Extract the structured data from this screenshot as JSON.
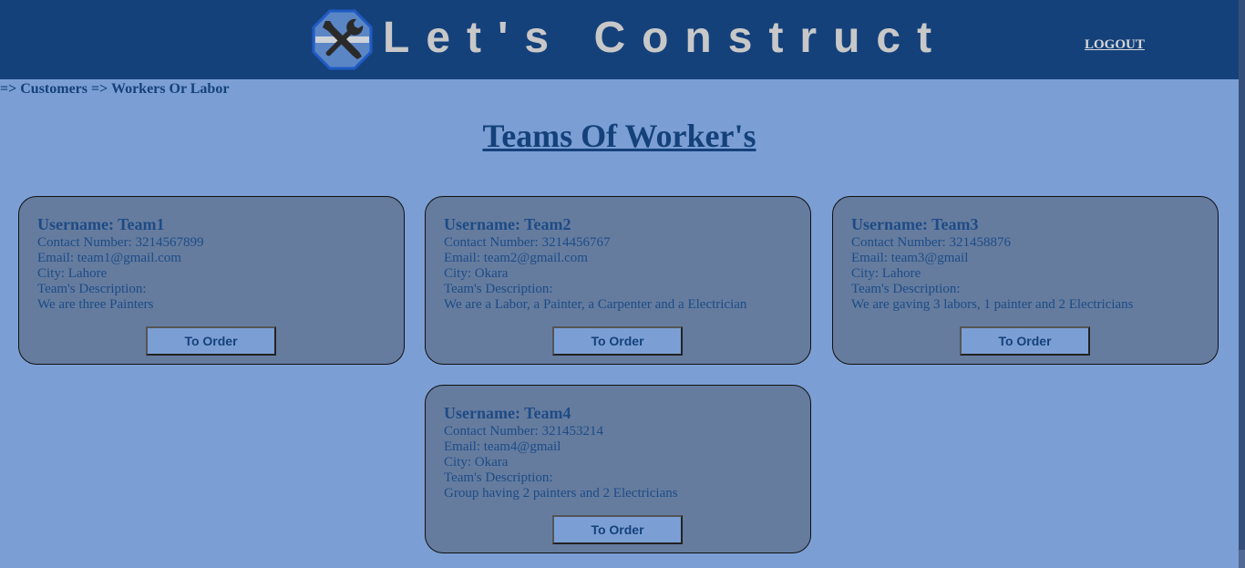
{
  "header": {
    "brand": "Let's Construct",
    "logout_label": "LOGOUT"
  },
  "breadcrumb": "=> Customers => Workers Or Labor",
  "page_title": "Teams Of Worker's",
  "teams": [
    {
      "username": "Username: Team1",
      "contact": "Contact Number: 3214567899",
      "email": "Email: team1@gmail.com",
      "city": "City: Lahore",
      "desc_label": "Team's Description:",
      "description": "We are three Painters",
      "button": "To Order"
    },
    {
      "username": "Username: Team2",
      "contact": "Contact Number: 3214456767",
      "email": "Email: team2@gmail.com",
      "city": "City: Okara",
      "desc_label": "Team's Description:",
      "description": "We are a Labor, a Painter, a Carpenter and a Electrician",
      "button": "To Order"
    },
    {
      "username": "Username: Team3",
      "contact": "Contact Number: 321458876",
      "email": "Email: team3@gmail",
      "city": "City: Lahore",
      "desc_label": "Team's Description:",
      "description": "We are gaving 3 labors, 1 painter and 2 Electricians",
      "button": "To Order"
    },
    {
      "username": "Username: Team4",
      "contact": "Contact Number: 321453214",
      "email": "Email: team4@gmail",
      "city": "City: Okara",
      "desc_label": "Team's Description:",
      "description": "Group having 2 painters and 2 Electricians",
      "button": "To Order"
    }
  ],
  "colors": {
    "header_bg": "#15417b",
    "page_bg": "#7b9fd4",
    "card_bg": "#657c9f",
    "text": "#1e4b85"
  },
  "icons": {
    "logo": "wrench-screwdriver-icon"
  }
}
